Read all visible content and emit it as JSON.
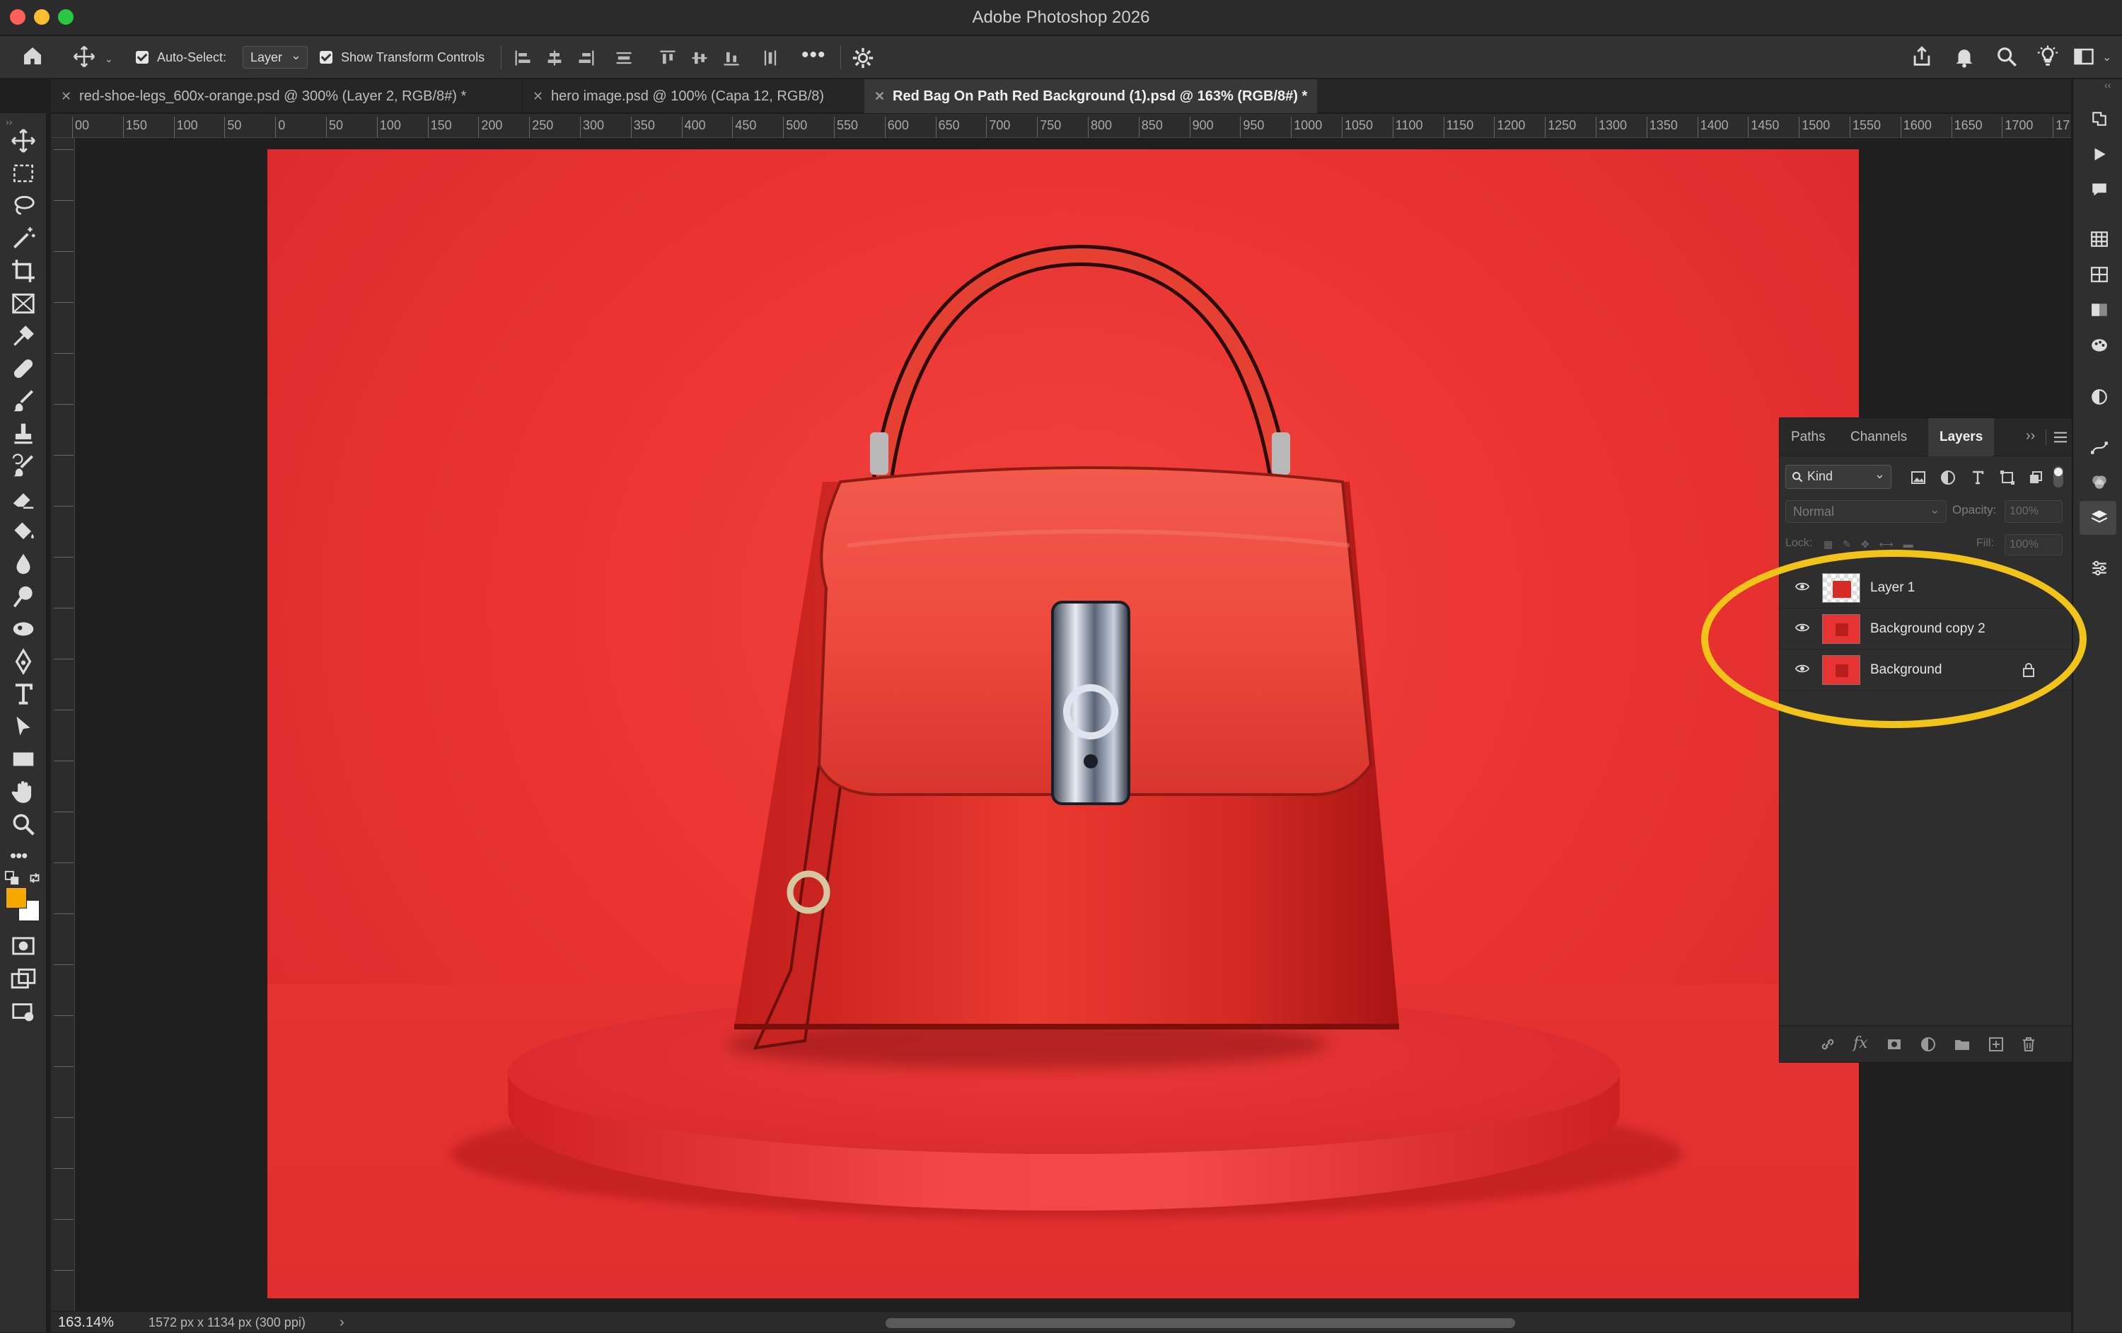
{
  "window": {
    "title": "Adobe Photoshop 2026"
  },
  "options_bar": {
    "auto_select_label": "Auto-Select:",
    "auto_select_value": "Layer",
    "show_transform_label": "Show Transform Controls"
  },
  "tabs": [
    {
      "label": "red-shoe-legs_600x-orange.psd @ 300% (Layer 2, RGB/8#) *",
      "active": false
    },
    {
      "label": "hero image.psd @ 100% (Capa 12, RGB/8)",
      "active": false
    },
    {
      "label": "Red Bag On Path Red Background (1).psd @ 163% (RGB/8#) *",
      "active": true
    }
  ],
  "ruler_ticks": [
    "00",
    "150",
    "100",
    "50",
    "0",
    "50",
    "100",
    "150",
    "200",
    "250",
    "300",
    "350",
    "400",
    "450",
    "500",
    "550",
    "600",
    "650",
    "700",
    "750",
    "800",
    "850",
    "900",
    "950",
    "1000",
    "1050",
    "1100",
    "1150",
    "1200",
    "1250",
    "1300",
    "1350",
    "1400",
    "1450",
    "1500",
    "1550",
    "1600",
    "1650",
    "1700",
    "17"
  ],
  "layers_panel": {
    "tabs": [
      "Paths",
      "Channels",
      "Layers"
    ],
    "filter_label": "Kind",
    "blend_mode": "Normal",
    "opacity_label": "Opacity:",
    "opacity_value": "100%",
    "lock_label": "Lock:",
    "fill_label": "Fill:",
    "fill_value": "100%",
    "layers": [
      {
        "name": "Layer 1",
        "visible": true,
        "locked": false
      },
      {
        "name": "Background copy 2",
        "visible": true,
        "locked": false
      },
      {
        "name": "Background",
        "visible": true,
        "locked": true
      }
    ]
  },
  "status": {
    "zoom": "163.14%",
    "doc_info": "1572 px x 1134 px (300 ppi)"
  },
  "colors": {
    "foreground": "#f5a800",
    "background": "#ffffff",
    "highlight": "#f2c318",
    "canvas_red": "#ea3431"
  },
  "icons": {
    "home": "home-icon",
    "move": "move-icon",
    "share": "share-icon",
    "bell": "bell-icon",
    "search": "search-icon",
    "lightbulb": "lightbulb-icon",
    "workspace": "workspace-icon",
    "settings": "gear-icon"
  }
}
